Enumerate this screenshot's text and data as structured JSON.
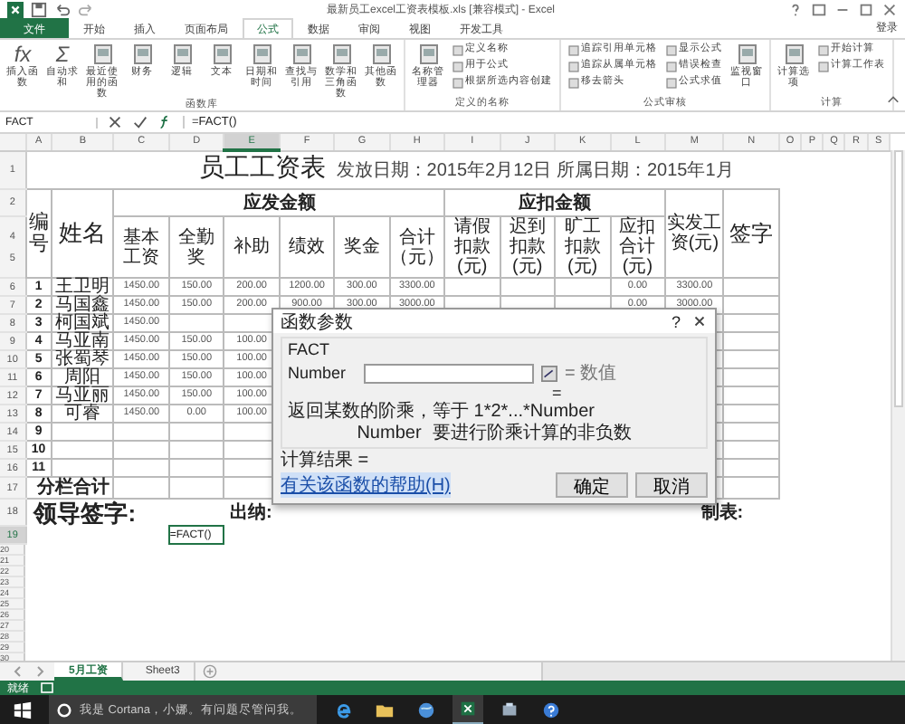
{
  "window": {
    "title": "最新员工excel工资表模板.xls [兼容模式] - Excel"
  },
  "ribbon_tabs": [
    {
      "label": "文件",
      "kind": "file",
      "selected": false
    },
    {
      "label": "开始",
      "kind": "tab",
      "selected": false
    },
    {
      "label": "插入",
      "kind": "tab",
      "selected": false
    },
    {
      "label": "页面布局",
      "kind": "tab",
      "selected": false
    },
    {
      "label": "公式",
      "kind": "tab",
      "selected": true
    },
    {
      "label": "数据",
      "kind": "tab",
      "selected": false
    },
    {
      "label": "审阅",
      "kind": "tab",
      "selected": false
    },
    {
      "label": "视图",
      "kind": "tab",
      "selected": false
    },
    {
      "label": "开发工具",
      "kind": "tab",
      "selected": false
    }
  ],
  "sign_in": "登录",
  "ribbon_groups": [
    {
      "label": "函数库",
      "items": [
        {
          "kind": "large",
          "glyph": "fx",
          "label": "插入函数"
        },
        {
          "kind": "large",
          "glyph": "Σ",
          "label": "自动求和"
        },
        {
          "kind": "large",
          "label": "最近使用的函数"
        },
        {
          "kind": "large",
          "label": "财务"
        },
        {
          "kind": "large",
          "label": "逻辑"
        },
        {
          "kind": "large",
          "label": "文本"
        },
        {
          "kind": "large",
          "label": "日期和时间"
        },
        {
          "kind": "large",
          "label": "查找与引用"
        },
        {
          "kind": "large",
          "label": "数学和三角函数"
        },
        {
          "kind": "large",
          "label": "其他函数"
        }
      ]
    },
    {
      "label": "定义的名称",
      "items": [
        {
          "kind": "large",
          "label": "名称管理器"
        },
        {
          "kind": "small",
          "labels": [
            "定义名称",
            "用于公式",
            "根据所选内容创建"
          ]
        }
      ]
    },
    {
      "label": "公式审核",
      "items": [
        {
          "kind": "small",
          "labels": [
            "追踪引用单元格",
            "追踪从属单元格",
            "移去箭头"
          ]
        },
        {
          "kind": "small",
          "labels": [
            "显示公式",
            "错误检查",
            "公式求值"
          ]
        },
        {
          "kind": "large",
          "label": "监视窗口"
        }
      ]
    },
    {
      "label": "计算",
      "items": [
        {
          "kind": "large",
          "label": "计算选项"
        },
        {
          "kind": "small",
          "labels": [
            "开始计算",
            "计算工作表"
          ]
        }
      ]
    }
  ],
  "formula_bar": {
    "name_box": "FACT",
    "formula": "=FACT()"
  },
  "columns": [
    {
      "letter": "A",
      "selected": false
    },
    {
      "letter": "B",
      "selected": false
    },
    {
      "letter": "C",
      "selected": false
    },
    {
      "letter": "D",
      "selected": false
    },
    {
      "letter": "E",
      "selected": true
    },
    {
      "letter": "F",
      "selected": false
    },
    {
      "letter": "G",
      "selected": false
    },
    {
      "letter": "H",
      "selected": false
    },
    {
      "letter": "I",
      "selected": false
    },
    {
      "letter": "J",
      "selected": false
    },
    {
      "letter": "K",
      "selected": false
    },
    {
      "letter": "L",
      "selected": false
    },
    {
      "letter": "M",
      "selected": false
    },
    {
      "letter": "N",
      "selected": false
    },
    {
      "letter": "O",
      "selected": false
    },
    {
      "letter": "P",
      "selected": false
    },
    {
      "letter": "Q",
      "selected": false
    },
    {
      "letter": "R",
      "selected": false
    },
    {
      "letter": "S",
      "selected": false
    }
  ],
  "title_row": {
    "row": "1",
    "title": "员工工资表",
    "dates": "发放日期：2015年2月12日 所属日期：2015年1月"
  },
  "header": {
    "row_numbers": [
      "2",
      "4",
      "5"
    ],
    "id_label": "编号",
    "name_label": "姓名",
    "income_group": "应发金额",
    "income_columns": [
      "基本工资",
      "全勤奖",
      "补助",
      "绩效",
      "奖金",
      "合计（元）"
    ],
    "deduction_group": "应扣金额",
    "deduction_columns": [
      "请假扣款(元)",
      "迟到扣款(元)",
      "旷工扣款(元)",
      "应扣合计(元)"
    ],
    "net_label": "实发工资(元)",
    "sign_label": "签字"
  },
  "data_rows": [
    {
      "row": "6",
      "no": "1",
      "name": "王卫明",
      "cells": {
        "C": "1450.00",
        "D": "150.00",
        "E": "200.00",
        "F": "1200.00",
        "G": "300.00",
        "H": "3300.00",
        "L": "0.00",
        "M": "3300.00"
      }
    },
    {
      "row": "7",
      "no": "2",
      "name": "马国鑫",
      "cells": {
        "C": "1450.00",
        "D": "150.00",
        "E": "200.00",
        "F": "900.00",
        "G": "300.00",
        "H": "3000.00",
        "L": "0.00",
        "M": "3000.00"
      }
    },
    {
      "row": "8",
      "no": "3",
      "name": "柯国斌",
      "cells": {
        "C": "1450.00"
      }
    },
    {
      "row": "9",
      "no": "4",
      "name": "马亚南",
      "cells": {
        "C": "1450.00",
        "D": "150.00",
        "E": "100.00"
      }
    },
    {
      "row": "10",
      "no": "5",
      "name": "张蜀琴",
      "cells": {
        "C": "1450.00",
        "D": "150.00",
        "E": "100.00"
      }
    },
    {
      "row": "11",
      "no": "6",
      "name": "周阳",
      "cells": {
        "C": "1450.00",
        "D": "150.00",
        "E": "100.00"
      }
    },
    {
      "row": "12",
      "no": "7",
      "name": "马亚丽",
      "cells": {
        "C": "1450.00",
        "D": "150.00",
        "E": "100.00"
      }
    },
    {
      "row": "13",
      "no": "8",
      "name": "可睿",
      "cells": {
        "C": "1450.00",
        "D": "0.00",
        "E": "100.00"
      }
    },
    {
      "row": "14",
      "no": "9",
      "cells": {}
    },
    {
      "row": "15",
      "no": "10",
      "cells": {}
    },
    {
      "row": "16",
      "no": "11",
      "cells": {}
    }
  ],
  "total_row": {
    "row": "17",
    "label": "分栏合计"
  },
  "sign_row": {
    "row": "18",
    "leader": "领导签字:",
    "cashier": "出纳:",
    "maker": "制表:"
  },
  "active_row": {
    "row": "19",
    "value": "=FACT()"
  },
  "empty_rows": [
    "20",
    "21",
    "22",
    "23",
    "24",
    "25",
    "26",
    "27",
    "28",
    "29",
    "30"
  ],
  "dialog": {
    "title": "函数参数",
    "help": "?",
    "function": "FACT",
    "argument": "Number",
    "argument_result": "= 数值",
    "result_equals": "=",
    "description": "返回某数的阶乘，等于 1*2*...*Number",
    "argument_name": "Number",
    "argument_description": "要进行阶乘计算的非负数",
    "result": "计算结果 =",
    "help_link": "有关该函数的帮助(H)",
    "ok": "确定",
    "cancel": "取消"
  },
  "sheet_tabs": [
    {
      "label": "5月工资",
      "selected": true
    },
    {
      "label": "Sheet3",
      "selected": false
    }
  ],
  "status_bar": {
    "text": "就绪"
  },
  "taskbar": {
    "search": "我是 Cortana，小娜。有问题尽管问我。"
  }
}
